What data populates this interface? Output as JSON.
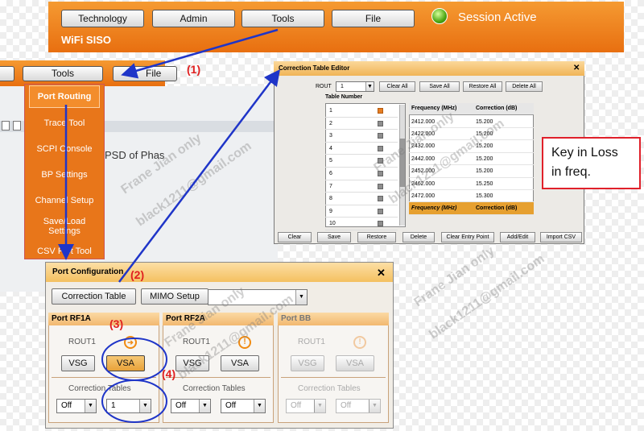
{
  "header": {
    "nav": [
      "Technology",
      "Admin",
      "Tools",
      "File"
    ],
    "subtitle": "WiFi SISO",
    "status": "Session Active"
  },
  "toolbar2": {
    "tools_label": "Tools",
    "file_label": "File"
  },
  "tools_menu": {
    "items": [
      "Port Routing",
      "Trace Tool",
      "SCPI Console",
      "BP Settings",
      "Channel Setup",
      "Save/Load Settings",
      "CSV Plot Tool"
    ]
  },
  "background": {
    "plot_label": "PSD of Phas"
  },
  "correction_editor": {
    "title": "Correction Table Editor",
    "rout_label": "ROUT",
    "rout_value": "1",
    "buttons_top": [
      "Clear All",
      "Save All",
      "Restore All",
      "Delete All"
    ],
    "table_number_label": "Table Number",
    "table_numbers": [
      "1",
      "2",
      "3",
      "4",
      "5",
      "6",
      "7",
      "8",
      "9",
      "10"
    ],
    "columns": [
      "Frequency (MHz)",
      "Correction (dB)"
    ],
    "rows": [
      [
        "2412.000",
        "15.200"
      ],
      [
        "2422.000",
        "15.200"
      ],
      [
        "2432.000",
        "15.200"
      ],
      [
        "2442.000",
        "15.200"
      ],
      [
        "2452.000",
        "15.200"
      ],
      [
        "2462.000",
        "15.250"
      ],
      [
        "2472.000",
        "15.300"
      ]
    ],
    "selected_row": [
      "Frequency (MHz)",
      "Correction (dB)"
    ],
    "buttons_bottom": [
      "Clear",
      "Save",
      "Restore",
      "Delete",
      "Clear Entry Point",
      "Add/Edit",
      "Import CSV"
    ]
  },
  "key_note": {
    "line1": "Key in Loss",
    "line2": "in freq."
  },
  "port_config": {
    "title": "Port Configuration",
    "btn_correction": "Correction Table",
    "btn_mimo": "MIMO Setup",
    "ports": [
      {
        "name": "Port RF1A",
        "rout": "ROUT1",
        "vsg": "VSG",
        "vsa": "VSA",
        "corr_label": "Correction Tables",
        "sel1": "Off",
        "sel2": "1",
        "enabled": true
      },
      {
        "name": "Port RF2A",
        "rout": "ROUT1",
        "vsg": "VSG",
        "vsa": "VSA",
        "corr_label": "Correction Tables",
        "sel1": "Off",
        "sel2": "Off",
        "enabled": true
      },
      {
        "name": "Port BB",
        "rout": "ROUT1",
        "vsg": "VSG",
        "vsa": "VSA",
        "corr_label": "Correction Tables",
        "sel1": "Off",
        "sel2": "Off",
        "enabled": false
      }
    ]
  },
  "annotations": [
    "(1)",
    "(2)",
    "(3)",
    "(4)"
  ],
  "watermark": [
    "Frane Jian only",
    "black1211@gmail.com"
  ],
  "colors": {
    "orange": "#e8761a",
    "accent_red": "#e02020",
    "arrow_blue": "#1f35c8"
  }
}
